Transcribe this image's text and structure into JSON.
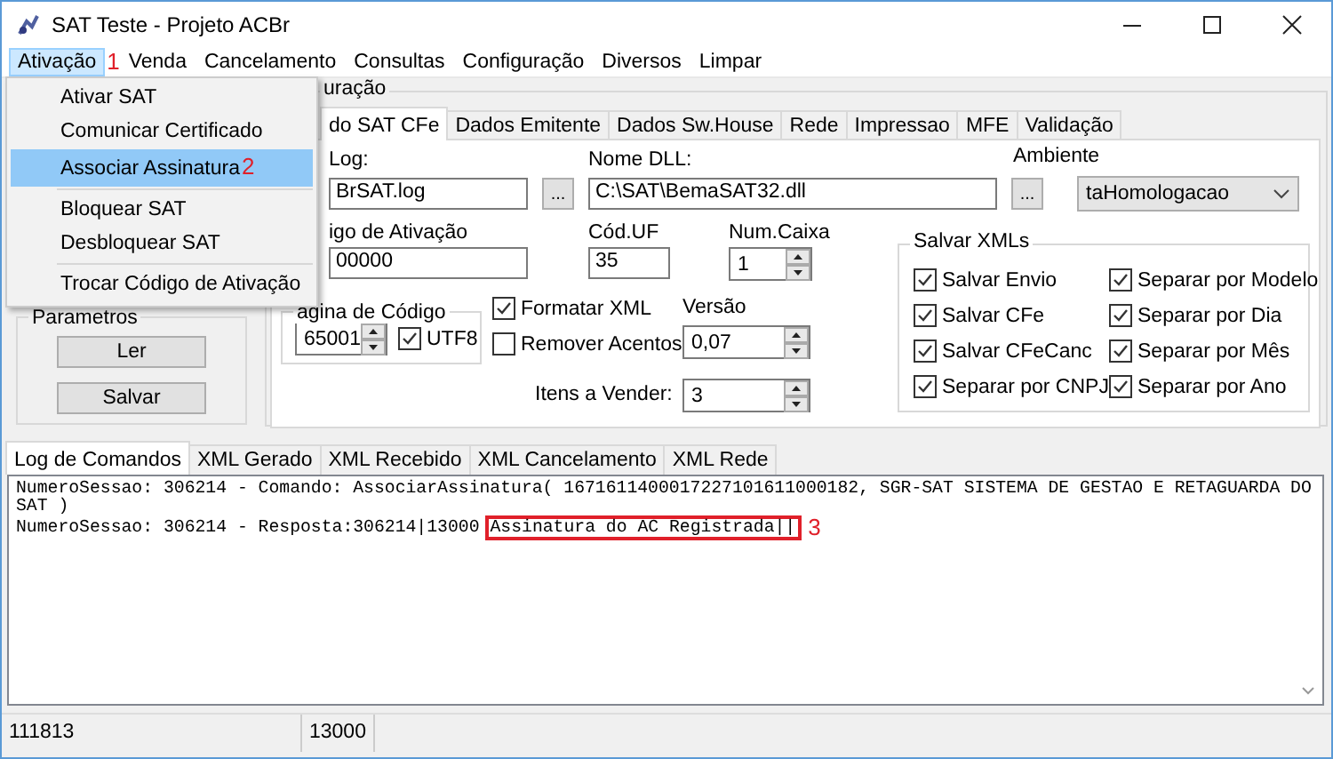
{
  "window": {
    "title": "SAT Teste - Projeto ACBr"
  },
  "menu_bar": [
    {
      "label": "Ativação",
      "selected": true,
      "annotation": "1"
    },
    {
      "label": "Venda",
      "selected": false
    },
    {
      "label": "Cancelamento",
      "selected": false
    },
    {
      "label": "Consultas",
      "selected": false
    },
    {
      "label": "Configuração",
      "selected": false
    },
    {
      "label": "Diversos",
      "selected": false
    },
    {
      "label": "Limpar",
      "selected": false
    }
  ],
  "dropdown": [
    {
      "kind": "item",
      "label": "Ativar SAT",
      "selected": false
    },
    {
      "kind": "item",
      "label": "Comunicar Certificado",
      "selected": false
    },
    {
      "kind": "item",
      "label": "Associar Assinatura",
      "selected": true,
      "annotation": "2"
    },
    {
      "kind": "separator"
    },
    {
      "kind": "item",
      "label": "Bloquear SAT",
      "selected": false
    },
    {
      "kind": "item",
      "label": "Desbloquear SAT",
      "selected": false
    },
    {
      "kind": "separator"
    },
    {
      "kind": "item",
      "label": "Trocar  Código de Ativação",
      "selected": false
    }
  ],
  "parametros": {
    "title": "Parametros",
    "buttons": [
      "Ler",
      "Salvar"
    ]
  },
  "config": {
    "title": "uração",
    "tabs": [
      {
        "label": "do SAT CFe",
        "selected": true
      },
      {
        "label": "Dados Emitente",
        "selected": false
      },
      {
        "label": "Dados Sw.House",
        "selected": false
      },
      {
        "label": "Rede",
        "selected": false
      },
      {
        "label": "Impressao",
        "selected": false
      },
      {
        "label": "MFE",
        "selected": false
      },
      {
        "label": "Validação",
        "selected": false
      }
    ],
    "log_label": "Log:",
    "log_file": "BrSAT.log",
    "log_browse": "...",
    "dll_label": "Nome DLL:",
    "dll_path": "C:\\SAT\\BemaSAT32.dll",
    "dll_browse": "...",
    "ambiente_label": "Ambiente",
    "ambiente": "taHomologacao",
    "codigo_label": "igo de Ativação",
    "codigo": "00000",
    "uf_label": "Cód.UF",
    "uf": "35",
    "caixa_label": "Num.Caixa",
    "caixa": "1",
    "pagina": {
      "title": "agina de Código",
      "value": "65001",
      "utf8": {
        "label": "UTF8",
        "checked": true
      }
    },
    "formatar_xml": {
      "label": "Formatar XML",
      "checked": true
    },
    "remover_acentos": {
      "label": "Remover Acentos",
      "checked": false
    },
    "versao_label": "Versão",
    "versao": "0,07",
    "itens_label": "Itens a Vender:",
    "itens": "3",
    "salvar_xmls": {
      "title": "Salvar XMLs",
      "options": [
        {
          "label": "Salvar Envio",
          "checked": true
        },
        {
          "label": "Separar por Modelo",
          "checked": true
        },
        {
          "label": "Salvar CFe",
          "checked": true
        },
        {
          "label": "Separar por Dia",
          "checked": true
        },
        {
          "label": "Salvar CFeCanc",
          "checked": true
        },
        {
          "label": "Separar por Mês",
          "checked": true
        },
        {
          "label": "Separar por CNPJ",
          "checked": true
        },
        {
          "label": "Separar por Ano",
          "checked": true
        }
      ]
    }
  },
  "log_tabs": [
    {
      "label": "Log de Comandos",
      "selected": true
    },
    {
      "label": "XML Gerado",
      "selected": false
    },
    {
      "label": "XML Recebido",
      "selected": false
    },
    {
      "label": "XML Cancelamento",
      "selected": false
    },
    {
      "label": "XML Rede",
      "selected": false
    }
  ],
  "log": {
    "lines": [
      "NumeroSessao: 306214 - Comando: AssociarAssinatura( 1671611400017227101611000182, SGR-SAT SISTEMA DE GESTAO E RETAGUARDA DO",
      "SAT )",
      "NumeroSessao: 306214 - Resposta:306214|13000"
    ],
    "highlight": {
      "text": "Assinatura do AC Registrada||",
      "annotation": "3"
    }
  },
  "status_bar": [
    "111813",
    "13000"
  ]
}
